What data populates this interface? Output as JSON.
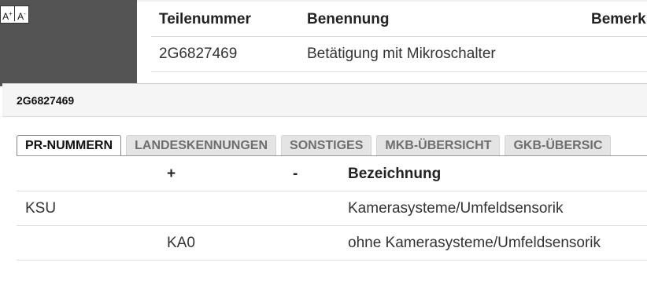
{
  "font_tools": {
    "increase": "A",
    "increase_mark": "+",
    "decrease": "A",
    "decrease_mark": "-"
  },
  "parts_table": {
    "headers": [
      "Teilenummer",
      "Benennung",
      "Bemerk"
    ],
    "rows": [
      [
        "2G6827469",
        "Betätigung mit Mikroschalter",
        ""
      ]
    ]
  },
  "dialog": {
    "title": "2G6827469",
    "tabs": [
      {
        "label": "PR-NUMMERN",
        "active": true
      },
      {
        "label": "LANDESKENNUNGEN",
        "active": false
      },
      {
        "label": "SONSTIGES",
        "active": false
      },
      {
        "label": "MKB-ÜBERSICHT",
        "active": false
      },
      {
        "label": "GKB-ÜBERSIC",
        "active": false
      }
    ],
    "pr_table": {
      "headers": [
        "",
        "+",
        "-",
        "Bezeichnung"
      ],
      "rows": [
        [
          "KSU",
          "",
          "",
          "Kamerasysteme/Umfeldsensorik"
        ],
        [
          "",
          "KA0",
          "",
          "ohne Kamerasysteme/Umfeldsensorik"
        ]
      ]
    }
  }
}
